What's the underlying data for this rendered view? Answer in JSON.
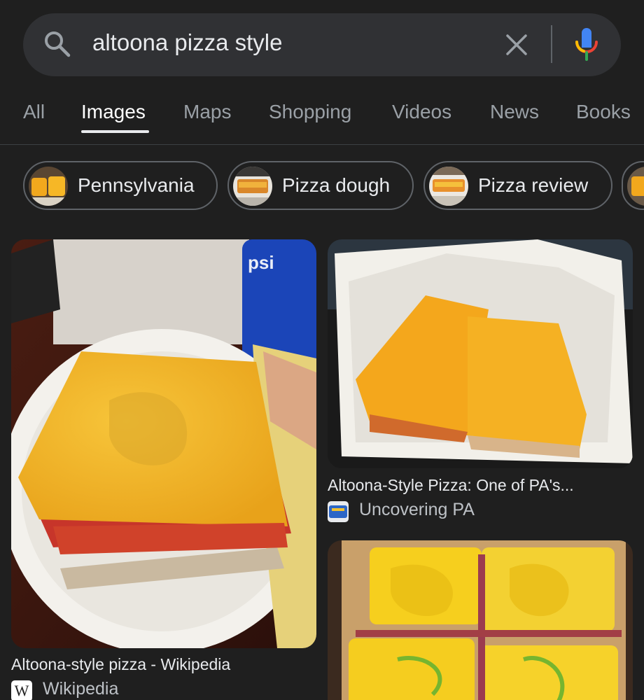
{
  "search": {
    "query": "altoona pizza style"
  },
  "tabs": [
    {
      "label": "All"
    },
    {
      "label": "Images",
      "active": true
    },
    {
      "label": "Maps"
    },
    {
      "label": "Shopping"
    },
    {
      "label": "Videos"
    },
    {
      "label": "News"
    },
    {
      "label": "Books"
    }
  ],
  "chips": [
    {
      "label": "Pennsylvania"
    },
    {
      "label": "Pizza dough"
    },
    {
      "label": "Pizza review"
    }
  ],
  "results": [
    {
      "title": "Altoona-style pizza - Wikipedia",
      "source": "Wikipedia",
      "source_icon_text": "W"
    },
    {
      "title": "Altoona-Style Pizza: One of PA's...",
      "source": "Uncovering PA"
    },
    {
      "title": "",
      "source": ""
    }
  ],
  "icons": {
    "search": "search-icon",
    "clear": "close-icon",
    "mic": "microphone-icon"
  },
  "colors": {
    "background": "#1f1f1f",
    "search_bar": "#303134",
    "cheese": "#f2b51f",
    "accent_blue": "#4285f4",
    "accent_red": "#ea4335"
  }
}
